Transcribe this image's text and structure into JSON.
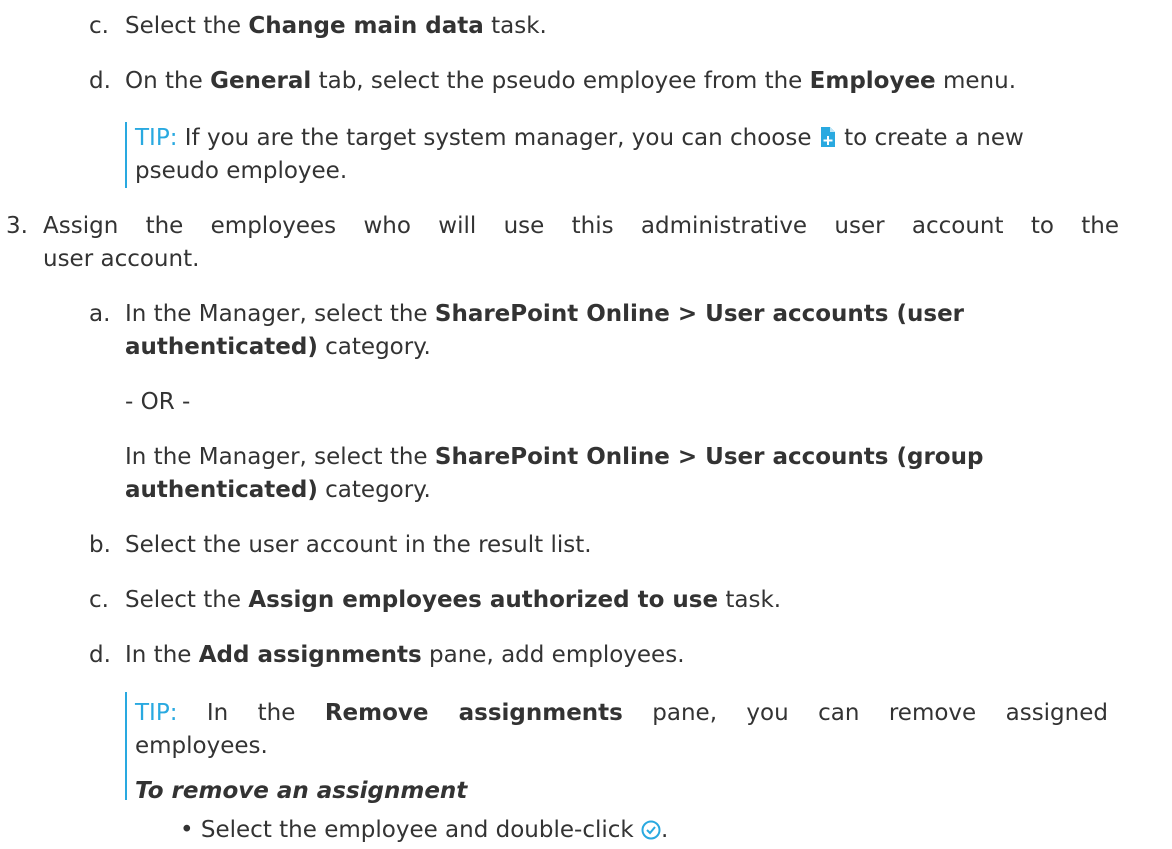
{
  "steps": {
    "c1": {
      "marker": "c.",
      "pre": "Select the ",
      "bold": "Change main data",
      "post": " task."
    },
    "d1": {
      "marker": "d.",
      "pre": "On the ",
      "bold1": "General",
      "mid": " tab, select the pseudo employee from the ",
      "bold2": "Employee",
      "post": " menu."
    },
    "tip1": {
      "label": "TIP:",
      "pre": " If you are the target system manager, you can choose ",
      "post": " to create a new",
      "line2": "pseudo employee.",
      "icon": "new-document-icon"
    },
    "s3": {
      "marker": "3.",
      "line1": "Assign the employees who will use this administrative user account to the",
      "line2": "user account."
    },
    "a": {
      "marker": "a.",
      "pre": "In the Manager, select the ",
      "bold_line1": "SharePoint Online > User accounts (user",
      "bold_line2": "authenticated)",
      "post": " category."
    },
    "or": "- OR -",
    "alt": {
      "pre": "In the Manager, select the ",
      "bold_line1": "SharePoint Online > User accounts (group",
      "bold_line2": "authenticated)",
      "post": " category."
    },
    "b": {
      "marker": "b.",
      "text": "Select the user account in the result list."
    },
    "c2": {
      "marker": "c.",
      "pre": "Select the ",
      "bold": "Assign employees authorized to use",
      "post": " task."
    },
    "d2": {
      "marker": "d.",
      "pre": "In the ",
      "bold": "Add assignments",
      "post": " pane, add employees."
    },
    "tip2": {
      "label": "TIP:",
      "pre": " In the ",
      "bold": "Remove assignments",
      "post": " pane, you can remove assigned",
      "line2": "employees."
    },
    "sub_heading": "To remove an assignment",
    "bullet": {
      "text": "Select the employee and double-click ",
      "post": ".",
      "icon": "checkmark-circle-icon"
    }
  },
  "colors": {
    "text": "#333333",
    "tip": "#29a9e0",
    "icon_blue": "#29a9e0",
    "icon_green": "#4caf50"
  }
}
